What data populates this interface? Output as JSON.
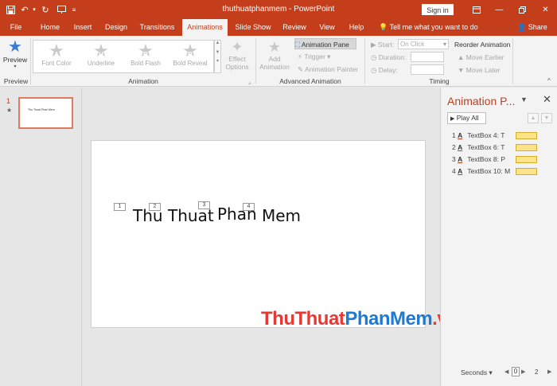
{
  "titlebar": {
    "title": "thuthuatphanmem - PowerPoint",
    "signin": "Sign in",
    "qat": {
      "save_icon": "save-icon",
      "undo_icon": "undo-icon",
      "redo_icon": "redo-icon",
      "present_icon": "start-from-beginning-icon"
    }
  },
  "tabs": [
    "File",
    "Home",
    "Insert",
    "Design",
    "Transitions",
    "Animations",
    "Slide Show",
    "Review",
    "View",
    "Help"
  ],
  "active_tab": "Animations",
  "tell_me": "Tell me what you want to do",
  "share": "Share",
  "ribbon": {
    "preview": {
      "label": "Preview",
      "group": "Preview"
    },
    "animation_group": "Animation",
    "gallery": [
      {
        "letter": "A",
        "label": "Font Color"
      },
      {
        "letter": "U",
        "label": "Underline"
      },
      {
        "letter": "B",
        "label": "Bold Flash"
      },
      {
        "letter": "B",
        "label": "Bold Reveal"
      }
    ],
    "effect_options": [
      "Effect",
      "Options"
    ],
    "add_animation": [
      "Add",
      "Animation"
    ],
    "advanced_group": "Advanced Animation",
    "animation_pane_btn": "Animation Pane",
    "trigger": "Trigger",
    "animation_painter": "Animation Painter",
    "timing_group": "Timing",
    "start_label": "Start:",
    "start_value": "On Click",
    "duration_label": "Duration:",
    "delay_label": "Delay:",
    "reorder": "Reorder Animation",
    "move_earlier": "Move Earlier",
    "move_later": "Move Later"
  },
  "thumbnails": [
    {
      "number": "1",
      "star": "★",
      "text": "Thu Thuat Phan Mem"
    }
  ],
  "slide": {
    "words": [
      "Thu",
      "Thuat",
      "Phan",
      "Mem"
    ],
    "tags": [
      "1",
      "2",
      "3",
      "4"
    ]
  },
  "watermark": {
    "part1": "ThuThuat",
    "part2": "PhanMem",
    "part3": ".vn",
    "color1": "#e53935",
    "color2": "#1f7ad1"
  },
  "anim_pane": {
    "title": "Animation P...",
    "play_all": "Play All",
    "items": [
      {
        "num": "1",
        "label": "TextBox 4: T"
      },
      {
        "num": "2",
        "label": "TextBox 6: T"
      },
      {
        "num": "3",
        "label": "TextBox 8: P"
      },
      {
        "num": "4",
        "label": "TextBox 10: M"
      }
    ],
    "seconds": "Seconds",
    "scale_start": "0",
    "scale_end": "2"
  },
  "colors": {
    "accent": "#c43e1c",
    "bar": "#ffe38a"
  }
}
